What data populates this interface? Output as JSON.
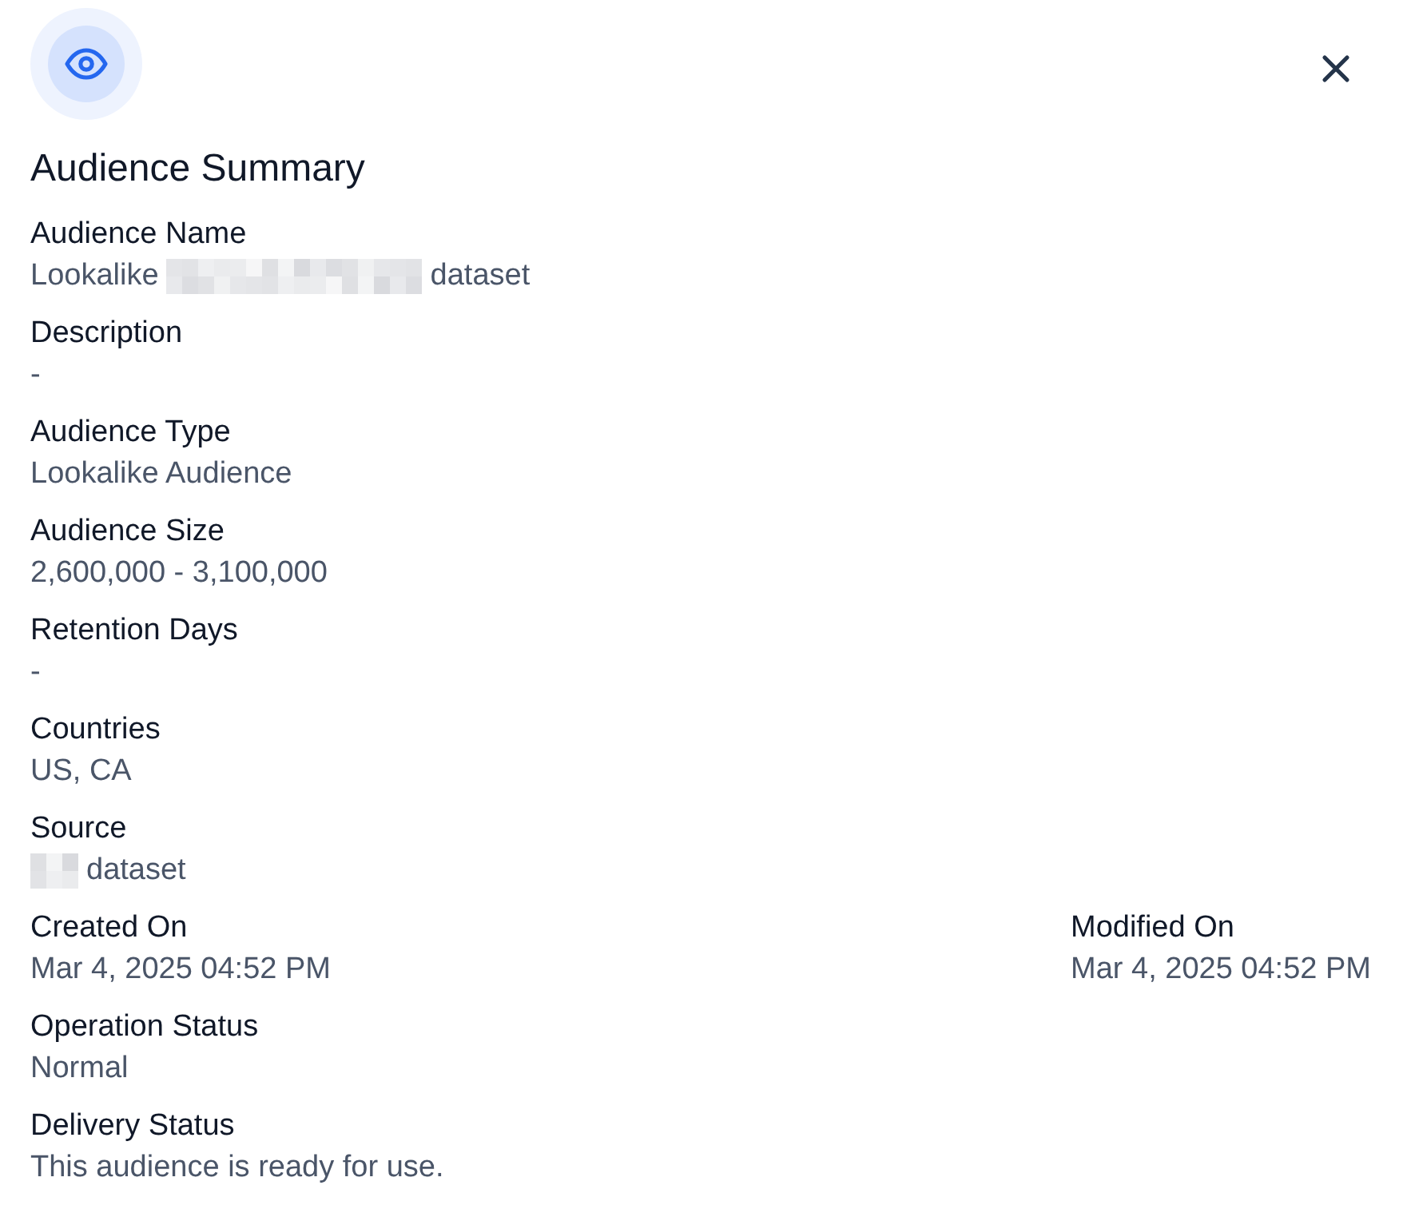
{
  "title": "Audience Summary",
  "rows": [
    {
      "fields": [
        {
          "label": "Audience Name",
          "value_parts": [
            {
              "kind": "text",
              "text": "Lookalike"
            },
            {
              "kind": "redaction_long"
            },
            {
              "kind": "text",
              "text": "dataset"
            }
          ]
        }
      ]
    },
    {
      "fields": [
        {
          "label": "Description",
          "value": "-"
        }
      ]
    },
    {
      "fields": [
        {
          "label": "Audience Type",
          "value": "Lookalike Audience"
        }
      ]
    },
    {
      "fields": [
        {
          "label": "Audience Size",
          "value": "2,600,000 - 3,100,000"
        }
      ]
    },
    {
      "fields": [
        {
          "label": "Retention Days",
          "value": "-"
        }
      ]
    },
    {
      "fields": [
        {
          "label": "Countries",
          "value": "US, CA"
        }
      ]
    },
    {
      "fields": [
        {
          "label": "Source",
          "value_parts": [
            {
              "kind": "redaction_short"
            },
            {
              "kind": "text",
              "text": "dataset"
            }
          ]
        }
      ]
    },
    {
      "fields": [
        {
          "label": "Created On",
          "value": "Mar 4, 2025 04:52 PM"
        },
        {
          "label": "Modified On",
          "value": "Mar 4, 2025 04:52 PM"
        }
      ]
    },
    {
      "fields": [
        {
          "label": "Operation Status",
          "value": "Normal"
        }
      ]
    },
    {
      "fields": [
        {
          "label": "Delivery Status",
          "value": "This audience is ready for use."
        }
      ]
    }
  ]
}
